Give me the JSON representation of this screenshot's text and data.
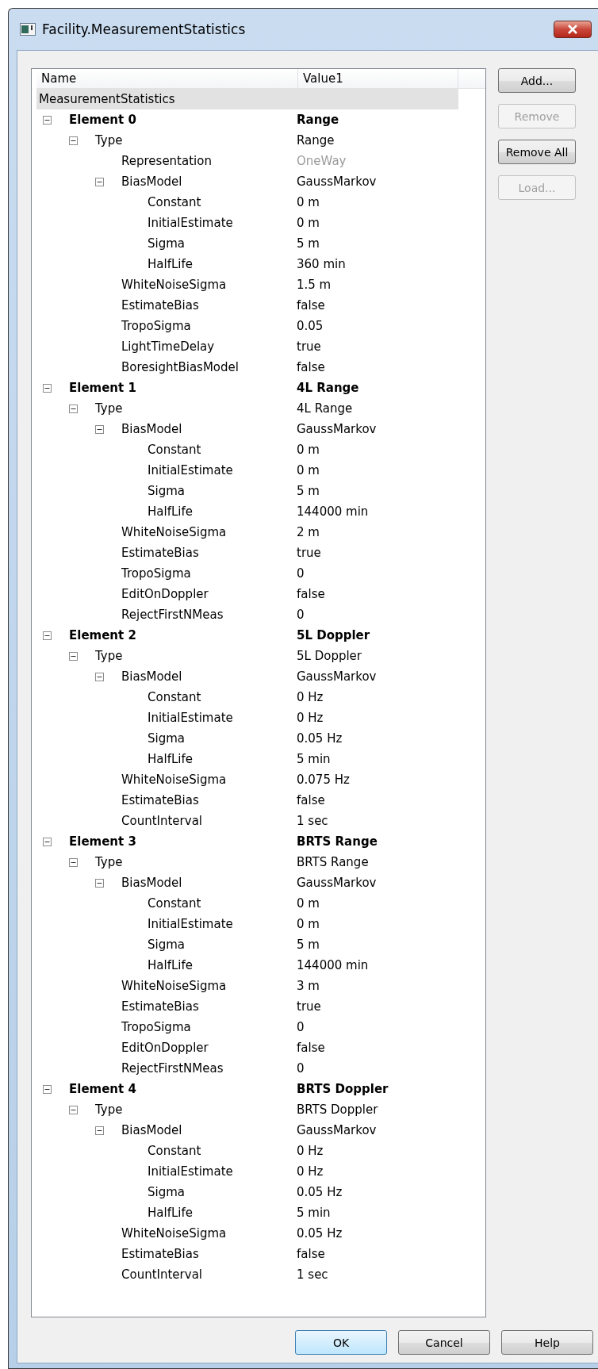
{
  "window": {
    "title": "Facility.MeasurementStatistics"
  },
  "columns": [
    "Name",
    "Value1"
  ],
  "root": "MeasurementStatistics",
  "tree": [
    {
      "name": "Element 0",
      "value": "Range",
      "expanded": true,
      "children": [
        {
          "name": "Type",
          "value": "Range",
          "expanded": true,
          "children": [
            {
              "name": "Representation",
              "value": "OneWay",
              "disabled": true
            },
            {
              "name": "BiasModel",
              "value": "GaussMarkov",
              "disabled": false,
              "expanded": true,
              "children": [
                {
                  "name": "Constant",
                  "value": "0 m"
                },
                {
                  "name": "InitialEstimate",
                  "value": "0 m"
                },
                {
                  "name": "Sigma",
                  "value": "5 m"
                },
                {
                  "name": "HalfLife",
                  "value": "360 min"
                }
              ]
            },
            {
              "name": "WhiteNoiseSigma",
              "value": "1.5 m",
              "disabled": false
            },
            {
              "name": "EstimateBias",
              "value": "false",
              "disabled": false
            },
            {
              "name": "TropoSigma",
              "value": "0.05",
              "disabled": false
            },
            {
              "name": "LightTimeDelay",
              "value": "true",
              "disabled": false
            },
            {
              "name": "BoresightBiasModel",
              "value": "false",
              "disabled": false
            }
          ]
        }
      ]
    },
    {
      "name": "Element 1",
      "value": "4L Range",
      "expanded": true,
      "children": [
        {
          "name": "Type",
          "value": "4L Range",
          "expanded": true,
          "children": [
            {
              "name": "BiasModel",
              "value": "GaussMarkov",
              "expanded": true,
              "children": [
                {
                  "name": "Constant",
                  "value": "0 m"
                },
                {
                  "name": "InitialEstimate",
                  "value": "0 m"
                },
                {
                  "name": "Sigma",
                  "value": "5 m"
                },
                {
                  "name": "HalfLife",
                  "value": "144000 min"
                }
              ]
            },
            {
              "name": "WhiteNoiseSigma",
              "value": "2 m"
            },
            {
              "name": "EstimateBias",
              "value": "true"
            },
            {
              "name": "TropoSigma",
              "value": "0"
            },
            {
              "name": "EditOnDoppler",
              "value": "false"
            },
            {
              "name": "RejectFirstNMeas",
              "value": "0"
            }
          ]
        }
      ]
    },
    {
      "name": "Element 2",
      "value": "5L Doppler",
      "expanded": true,
      "children": [
        {
          "name": "Type",
          "value": "5L Doppler",
          "expanded": true,
          "children": [
            {
              "name": "BiasModel",
              "value": "GaussMarkov",
              "expanded": true,
              "children": [
                {
                  "name": "Constant",
                  "value": "0 Hz"
                },
                {
                  "name": "InitialEstimate",
                  "value": "0 Hz"
                },
                {
                  "name": "Sigma",
                  "value": "0.05 Hz"
                },
                {
                  "name": "HalfLife",
                  "value": "5 min"
                }
              ]
            },
            {
              "name": "WhiteNoiseSigma",
              "value": "0.075 Hz"
            },
            {
              "name": "EstimateBias",
              "value": "false"
            },
            {
              "name": "CountInterval",
              "value": "1 sec"
            }
          ]
        }
      ]
    },
    {
      "name": "Element 3",
      "value": "BRTS Range",
      "expanded": true,
      "children": [
        {
          "name": "Type",
          "value": "BRTS Range",
          "expanded": true,
          "children": [
            {
              "name": "BiasModel",
              "value": "GaussMarkov",
              "expanded": true,
              "children": [
                {
                  "name": "Constant",
                  "value": "0 m"
                },
                {
                  "name": "InitialEstimate",
                  "value": "0 m"
                },
                {
                  "name": "Sigma",
                  "value": "5 m"
                },
                {
                  "name": "HalfLife",
                  "value": "144000 min"
                }
              ]
            },
            {
              "name": "WhiteNoiseSigma",
              "value": "3 m"
            },
            {
              "name": "EstimateBias",
              "value": "true"
            },
            {
              "name": "TropoSigma",
              "value": "0"
            },
            {
              "name": "EditOnDoppler",
              "value": "false"
            },
            {
              "name": "RejectFirstNMeas",
              "value": "0"
            }
          ]
        }
      ]
    },
    {
      "name": "Element 4",
      "value": "BRTS Doppler",
      "expanded": true,
      "children": [
        {
          "name": "Type",
          "value": "BRTS Doppler",
          "expanded": true,
          "children": [
            {
              "name": "BiasModel",
              "value": "GaussMarkov",
              "expanded": true,
              "children": [
                {
                  "name": "Constant",
                  "value": "0 Hz"
                },
                {
                  "name": "InitialEstimate",
                  "value": "0 Hz"
                },
                {
                  "name": "Sigma",
                  "value": "0.05 Hz"
                },
                {
                  "name": "HalfLife",
                  "value": "5 min"
                }
              ]
            },
            {
              "name": "WhiteNoiseSigma",
              "value": "0.05 Hz"
            },
            {
              "name": "EstimateBias",
              "value": "false"
            },
            {
              "name": "CountInterval",
              "value": "1 sec"
            }
          ]
        }
      ]
    }
  ],
  "side_buttons": [
    {
      "label": "Add...",
      "disabled": false
    },
    {
      "label": "Remove",
      "disabled": true
    },
    {
      "label": "Remove All",
      "disabled": false
    },
    {
      "label": "Load...",
      "disabled": true
    }
  ],
  "footer_buttons": [
    {
      "label": "OK",
      "default": true
    },
    {
      "label": "Cancel",
      "default": false
    },
    {
      "label": "Help",
      "default": false
    }
  ]
}
